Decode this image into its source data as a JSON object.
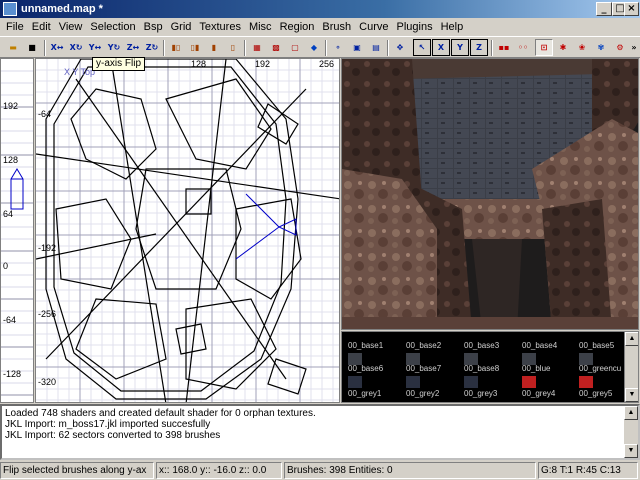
{
  "window": {
    "title": "unnamed.map *"
  },
  "title_buttons": {
    "minimize": "_",
    "maximize": "□",
    "close": "×"
  },
  "menu": [
    "File",
    "Edit",
    "View",
    "Selection",
    "Bsp",
    "Grid",
    "Textures",
    "Misc",
    "Region",
    "Brush",
    "Curve",
    "Plugins",
    "Help"
  ],
  "tooltip": "y-axis Flip",
  "z_view": {
    "tick_labels": [
      "192",
      "128",
      "64",
      "0",
      "-64",
      "-128"
    ]
  },
  "xy_view": {
    "label": "X Y Top",
    "top_ticks": [
      "128",
      "192",
      "256"
    ],
    "left_ticks": [
      "-64",
      "-192",
      "-256",
      "-320"
    ]
  },
  "textures": [
    {
      "name": "00_base1"
    },
    {
      "name": "00_base2"
    },
    {
      "name": "00_base3"
    },
    {
      "name": "00_base4"
    },
    {
      "name": "00_base5"
    },
    {
      "name": "00_base6"
    },
    {
      "name": "00_base7"
    },
    {
      "name": "00_base8"
    },
    {
      "name": "00_blue"
    },
    {
      "name": "00_greencu"
    },
    {
      "name": "00_grey1"
    },
    {
      "name": "00_grey2"
    },
    {
      "name": "00_grey3"
    },
    {
      "name": "00_grey4"
    },
    {
      "name": "00_grey5"
    }
  ],
  "console": {
    "lines": [
      "Loaded 748 shaders and created default shader for 0 orphan textures.",
      "JKL Import: m_boss17.jkl imported succesfully",
      "JKL Import: 62 sectors converted to 398 brushes"
    ]
  },
  "status": {
    "message": "Flip selected brushes along y-ax",
    "coords": "x:: 168.0  y:: -16.0  z:: 0.0",
    "counts": "Brushes: 398 Entities: 0",
    "grid": "G:8 T:1 R:45 C:13"
  },
  "colors": {
    "title_start": "#0a246a",
    "title_end": "#a6caf0",
    "selection_blue": "#0000c8",
    "texture_bg": "#000000",
    "camera_wall": "#3a3d44"
  }
}
